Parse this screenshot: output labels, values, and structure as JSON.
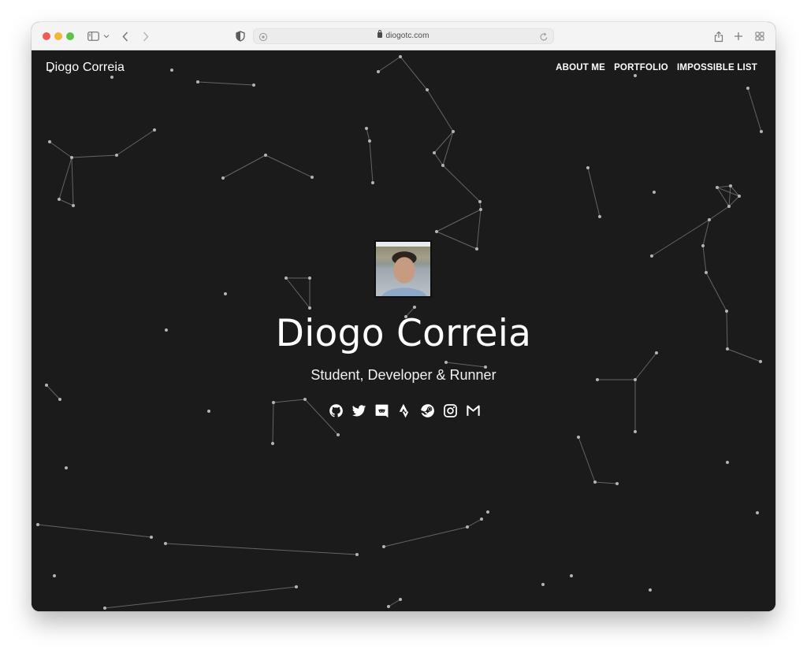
{
  "browser": {
    "url": "diogotc.com",
    "buttons": {
      "sidebar": "sidebar-toggle",
      "back": "back",
      "forward": "forward",
      "share": "share",
      "new_tab": "new-tab",
      "tab_overview": "tab-overview"
    }
  },
  "site": {
    "brand": "Diogo Correia",
    "nav": [
      {
        "label": "ABOUT ME"
      },
      {
        "label": "PORTFOLIO"
      },
      {
        "label": "IMPOSSIBLE LIST"
      }
    ]
  },
  "hero": {
    "avatar_alt": "Portrait photo of Diogo Correia",
    "name": "Diogo Correia",
    "tagline": "Student, Developer & Runner",
    "socials": [
      {
        "name": "github",
        "icon": "github-icon"
      },
      {
        "name": "twitter",
        "icon": "twitter-icon"
      },
      {
        "name": "discord",
        "icon": "discord-icon"
      },
      {
        "name": "strava",
        "icon": "strava-icon"
      },
      {
        "name": "steam",
        "icon": "steam-icon"
      },
      {
        "name": "instagram",
        "icon": "instagram-icon"
      },
      {
        "name": "gmail",
        "icon": "gmail-icon"
      }
    ]
  },
  "colors": {
    "background": "#1b1b1b",
    "text": "#ffffff",
    "star": "#b4b4b4",
    "star_link": "#7d7d7d",
    "toolbar": "#f4f4f4"
  }
}
